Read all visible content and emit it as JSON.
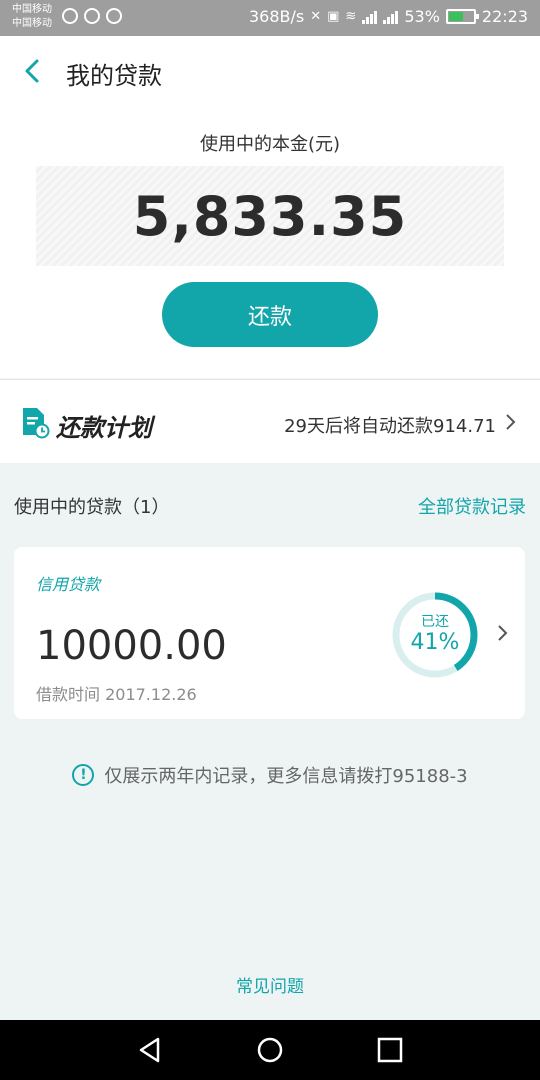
{
  "status_bar": {
    "carrier1": "中国移动",
    "carrier2": "中国移动",
    "net_speed": "368B/s",
    "battery": "53%",
    "time": "22:23"
  },
  "header": {
    "title": "我的贷款"
  },
  "principal": {
    "label": "使用中的本金(元)",
    "amount": "5,833.35"
  },
  "repay_button": "还款",
  "plan": {
    "title": "还款计划",
    "info": "29天后将自动还款914.71"
  },
  "loans": {
    "header": "使用中的贷款（1）",
    "all_records": "全部贷款记录",
    "items": [
      {
        "type": "信用贷款",
        "amount": "10000.00",
        "date": "借款时间 2017.12.26",
        "progress_label": "已还",
        "progress_text": "41%",
        "progress": 0.41
      }
    ]
  },
  "notice": "仅展示两年内记录，更多信息请拨打95188-3",
  "faq": "常见问题",
  "colors": {
    "accent": "#12a5aa",
    "ring_track": "#d9efef",
    "page_bg": "#eef4f4"
  }
}
